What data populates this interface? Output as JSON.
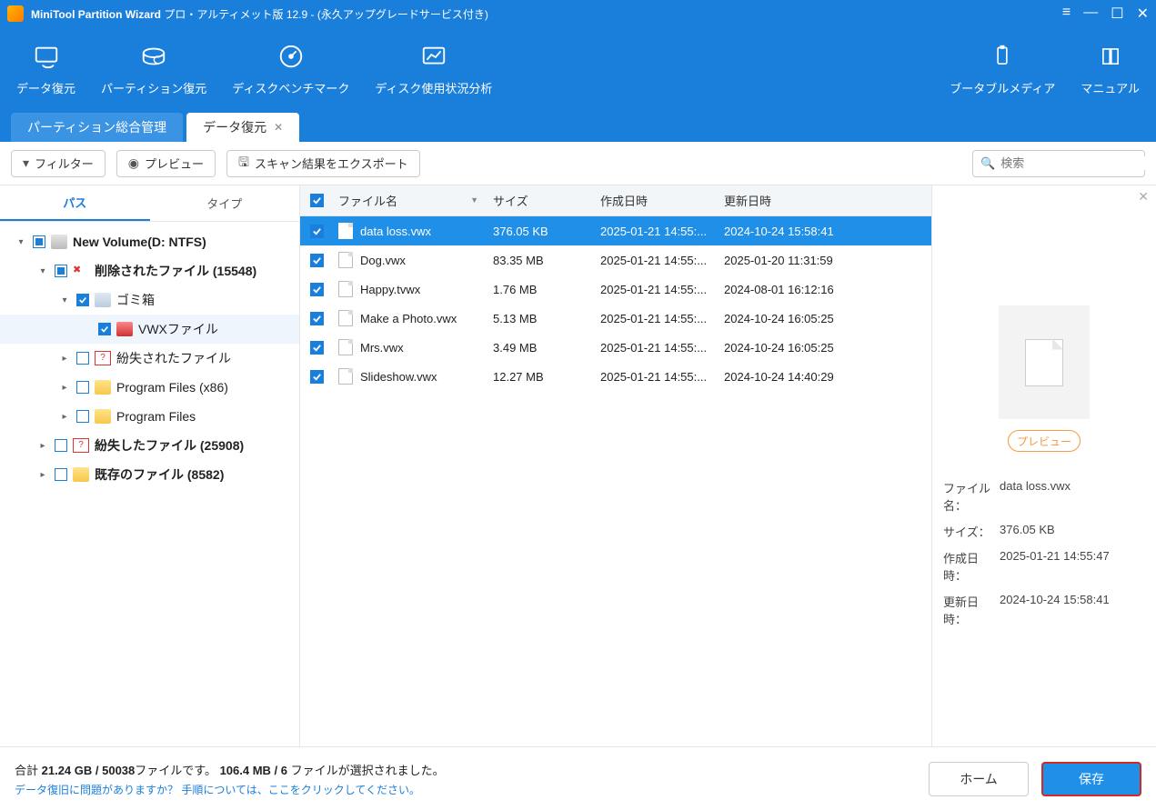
{
  "titlebar": {
    "app_name": "MiniTool Partition Wizard",
    "title_suffix": " プロ・アルティメット版 12.9 - (永久アップグレードサービス付き)"
  },
  "toolbar": {
    "items": [
      {
        "id": "data-recovery",
        "label": "データ復元"
      },
      {
        "id": "partition-recovery",
        "label": "パーティション復元"
      },
      {
        "id": "disk-benchmark",
        "label": "ディスクベンチマーク"
      },
      {
        "id": "disk-usage",
        "label": "ディスク使用状況分析"
      }
    ],
    "right_items": [
      {
        "id": "bootable-media",
        "label": "ブータブルメディア"
      },
      {
        "id": "manual",
        "label": "マニュアル"
      }
    ]
  },
  "tabs": [
    {
      "id": "partition-mgmt",
      "label": "パーティション総合管理",
      "active": false
    },
    {
      "id": "data-recovery-tab",
      "label": "データ復元",
      "active": true,
      "closable": true
    }
  ],
  "actionbar": {
    "filter": "フィルター",
    "preview": "プレビュー",
    "export": "スキャン結果をエクスポート",
    "search_placeholder": "検索"
  },
  "lefttabs": {
    "path": "パス",
    "type": "タイプ"
  },
  "tree": [
    {
      "depth": 0,
      "expand": "down",
      "check": "partial",
      "icon": "drive",
      "label": "New Volume(D: NTFS)",
      "bold": true
    },
    {
      "depth": 1,
      "expand": "down",
      "check": "partial",
      "icon": "x",
      "label": "削除されたファイル (15548)",
      "bold": true
    },
    {
      "depth": 2,
      "expand": "down",
      "check": "checked",
      "icon": "bin",
      "label": "ゴミ箱",
      "bold": false
    },
    {
      "depth": 3,
      "expand": "",
      "check": "checked",
      "icon": "vw",
      "label": "VWXファイル",
      "bold": false,
      "hover": true
    },
    {
      "depth": 2,
      "expand": "right",
      "check": "empty",
      "icon": "q",
      "label": "紛失されたファイル",
      "bold": false
    },
    {
      "depth": 2,
      "expand": "right",
      "check": "empty",
      "icon": "folder",
      "label": "Program Files (x86)",
      "bold": false
    },
    {
      "depth": 2,
      "expand": "right",
      "check": "empty",
      "icon": "folder",
      "label": "Program Files",
      "bold": false
    },
    {
      "depth": 1,
      "expand": "right",
      "check": "empty",
      "icon": "q",
      "label": "紛失したファイル (25908)",
      "bold": true
    },
    {
      "depth": 1,
      "expand": "right",
      "check": "empty",
      "icon": "folder",
      "label": "既存のファイル (8582)",
      "bold": true
    }
  ],
  "grid": {
    "headers": {
      "name": "ファイル名",
      "size": "サイズ",
      "cdate": "作成日時",
      "mdate": "更新日時"
    },
    "rows": [
      {
        "name": "data loss.vwx",
        "size": "376.05 KB",
        "cdate": "2025-01-21 14:55:...",
        "mdate": "2024-10-24 15:58:41",
        "selected": true
      },
      {
        "name": "Dog.vwx",
        "size": "83.35 MB",
        "cdate": "2025-01-21 14:55:...",
        "mdate": "2025-01-20 11:31:59"
      },
      {
        "name": "Happy.tvwx",
        "size": "1.76 MB",
        "cdate": "2025-01-21 14:55:...",
        "mdate": "2024-08-01 16:12:16"
      },
      {
        "name": "Make a Photo.vwx",
        "size": "5.13 MB",
        "cdate": "2025-01-21 14:55:...",
        "mdate": "2024-10-24 16:05:25"
      },
      {
        "name": "Mrs.vwx",
        "size": "3.49 MB",
        "cdate": "2025-01-21 14:55:...",
        "mdate": "2024-10-24 16:05:25"
      },
      {
        "name": "Slideshow.vwx",
        "size": "12.27 MB",
        "cdate": "2025-01-21 14:55:...",
        "mdate": "2024-10-24 14:40:29"
      }
    ]
  },
  "preview": {
    "btn": "プレビュー",
    "labels": {
      "name": "ファイル名：",
      "size": "サイズ：",
      "cdate": "作成日時：",
      "mdate": "更新日時："
    },
    "values": {
      "name": "data loss.vwx",
      "size": "376.05 KB",
      "cdate": "2025-01-21 14:55:47",
      "mdate": "2024-10-24 15:58:41"
    }
  },
  "footer": {
    "total_prefix": "合計 ",
    "total_size": "21.24 GB / 50038",
    "total_mid": "ファイルです。 ",
    "sel_size": "106.4 MB / 6",
    "sel_suffix": " ファイルが選択されました。",
    "help": "データ復旧に問題がありますか？ 手順については、ここをクリックしてください。",
    "home": "ホーム",
    "save": "保存"
  }
}
